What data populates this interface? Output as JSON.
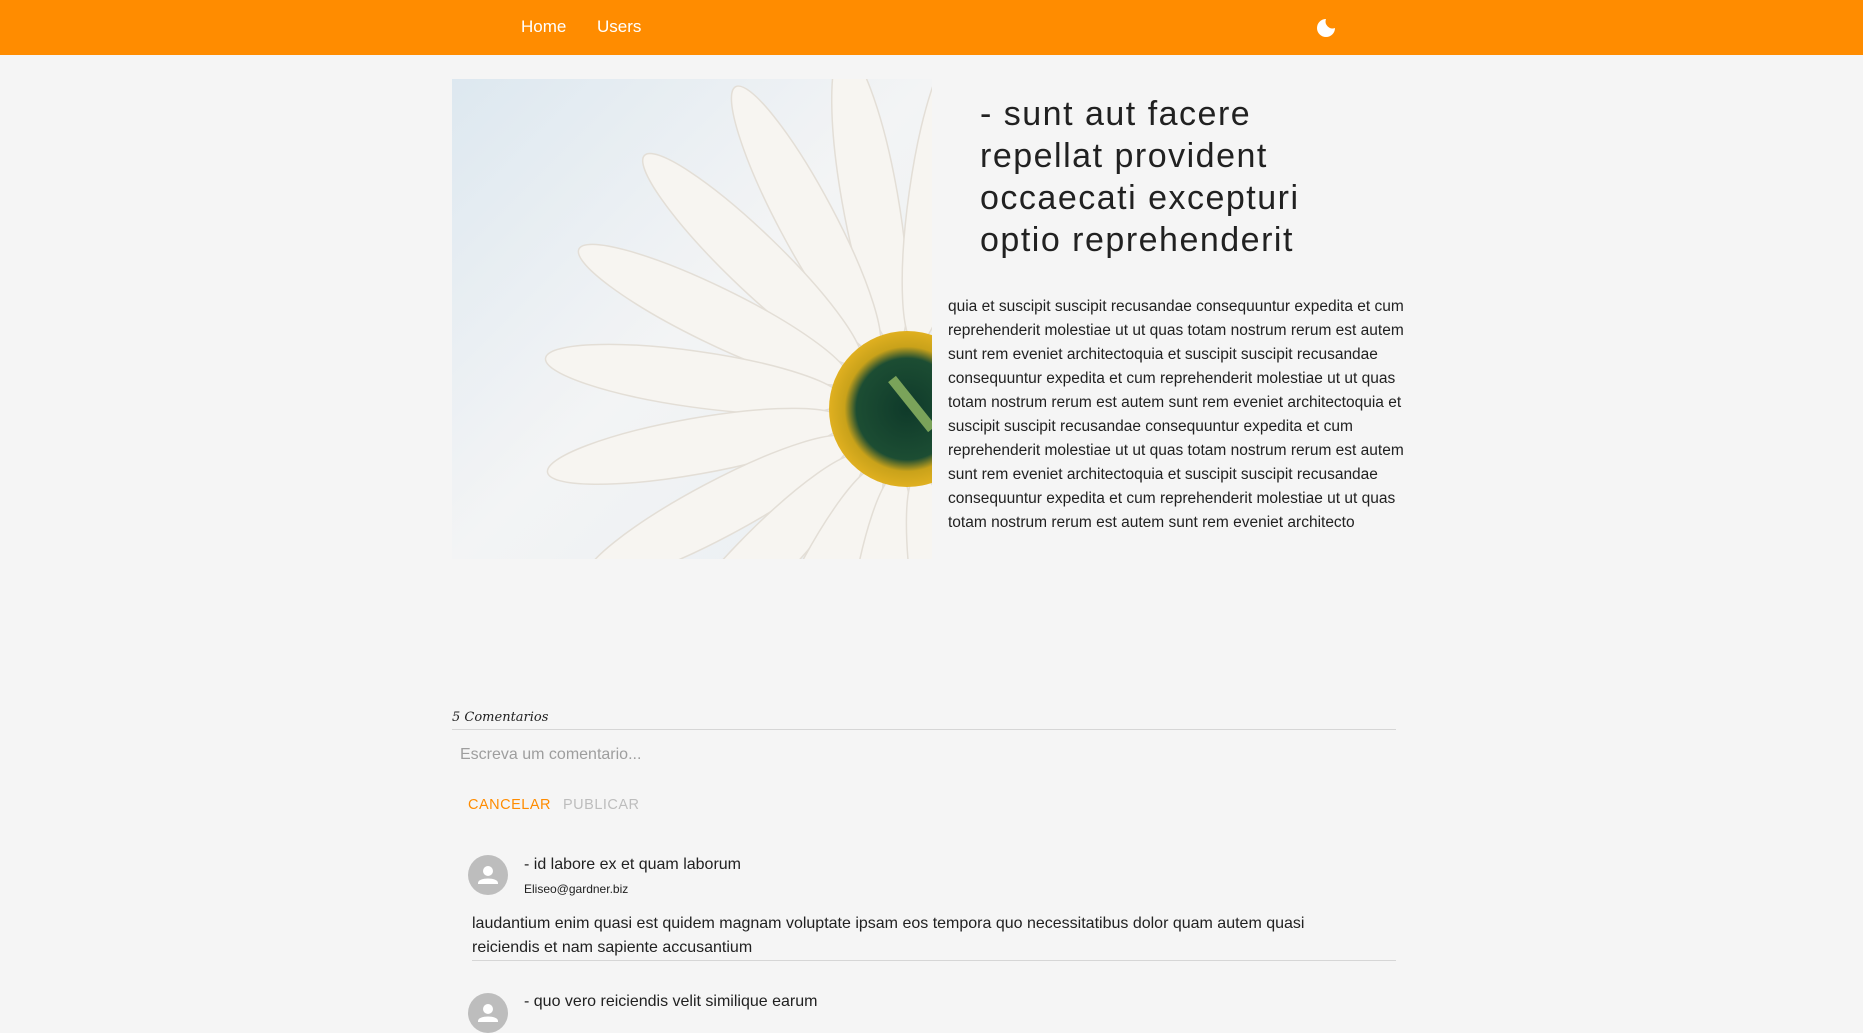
{
  "nav": {
    "home_label": "Home",
    "users_label": "Users",
    "theme_icon": "moon-icon"
  },
  "post": {
    "title": "- sunt aut facere repellat provident occaecati excepturi optio reprehenderit",
    "body": "quia et suscipit suscipit recusandae consequuntur expedita et cum reprehenderit molestiae ut ut quas totam nostrum rerum est autem sunt rem eveniet architectoquia et suscipit suscipit recusandae consequuntur expedita et cum reprehenderit molestiae ut ut quas totam nostrum rerum est autem sunt rem eveniet architectoquia et suscipit suscipit recusandae consequuntur expedita et cum reprehenderit molestiae ut ut quas totam nostrum rerum est autem sunt rem eveniet architectoquia et suscipit suscipit recusandae consequuntur expedita et cum reprehenderit molestiae ut ut quas totam nostrum rerum est autem sunt rem eveniet architecto"
  },
  "comments": {
    "count_label": "5 Comentarios",
    "input_placeholder": "Escreva um comentario...",
    "input_value": "",
    "cancel_label": "CANCELAR",
    "publish_label": "PUBLICAR",
    "items": [
      {
        "title": "- id labore ex et quam laborum",
        "email": "Eliseo@gardner.biz",
        "body": "laudantium enim quasi est quidem magnam voluptate ipsam eos tempora quo necessitatibus dolor quam autem quasi reiciendis et nam sapiente accusantium"
      },
      {
        "title": "- quo vero reiciendis velit similique earum"
      }
    ]
  },
  "colors": {
    "accent": "#ff8c00",
    "background": "#f5f5f5",
    "text": "#212121",
    "muted": "#bdbdbd"
  }
}
